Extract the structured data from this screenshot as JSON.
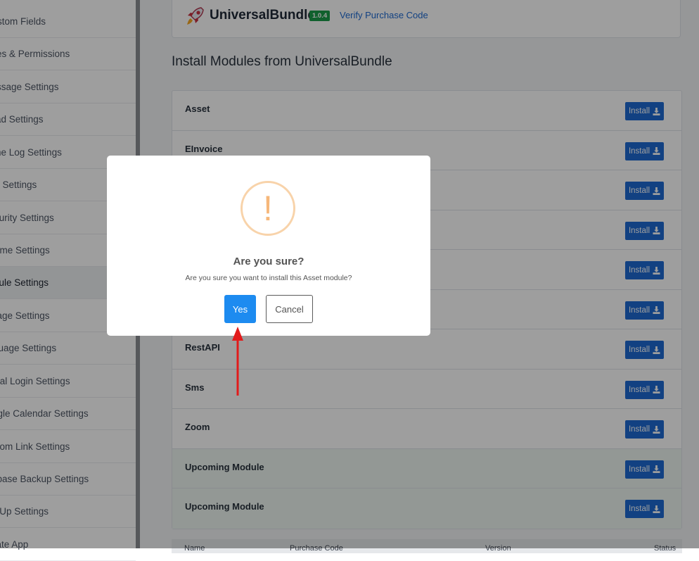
{
  "sidebar": {
    "items": [
      {
        "label": "stom Fields"
      },
      {
        "label": "es & Permissions"
      },
      {
        "label": "ssage Settings"
      },
      {
        "label": "ad Settings"
      },
      {
        "label": "ne Log Settings"
      },
      {
        "label": "k Settings"
      },
      {
        "label": "curity Settings"
      },
      {
        "label": "eme Settings"
      },
      {
        "label": "dule Settings"
      },
      {
        "label": "rage Settings"
      },
      {
        "label": "guage Settings"
      },
      {
        "label": "cial Login Settings"
      },
      {
        "label": "ogle Calendar Settings"
      },
      {
        "label": "stom Link Settings"
      },
      {
        "label": "abase Backup Settings"
      },
      {
        "label": "n Up Settings"
      },
      {
        "label": "date App"
      }
    ],
    "active_index": 8
  },
  "bundle": {
    "name": "UniversalBundle",
    "version": "1.0.4",
    "verify_label": "Verify Purchase Code"
  },
  "section_title": "Install Modules from UniversalBundle",
  "modules": [
    {
      "name": "Asset",
      "install_label": "Install"
    },
    {
      "name": "EInvoice",
      "install_label": "Install"
    },
    {
      "name": "",
      "install_label": "Install"
    },
    {
      "name": "",
      "install_label": "Install"
    },
    {
      "name": "",
      "install_label": "Install"
    },
    {
      "name": "",
      "install_label": "Install"
    },
    {
      "name": "RestAPI",
      "install_label": "Install"
    },
    {
      "name": "Sms",
      "install_label": "Install"
    },
    {
      "name": "Zoom",
      "install_label": "Install"
    },
    {
      "name": "Upcoming Module",
      "install_label": "Install"
    },
    {
      "name": "Upcoming Module",
      "install_label": "Install"
    }
  ],
  "table_head": {
    "name": "Name",
    "purchase_code": "Purchase Code",
    "version": "Version",
    "status": "Status"
  },
  "modal": {
    "icon": "exclamation-warning-icon",
    "title": "Are you sure?",
    "text": "Are you sure you want to install this Asset module?",
    "yes_label": "Yes",
    "cancel_label": "Cancel"
  },
  "colors": {
    "primary": "#1d6ad2",
    "confirm": "#1d8bf0",
    "badge": "#1a9b4a",
    "warning": "#f8d3aa",
    "arrow": "#e21b1b",
    "upcoming_bg": "#eef6f0"
  }
}
